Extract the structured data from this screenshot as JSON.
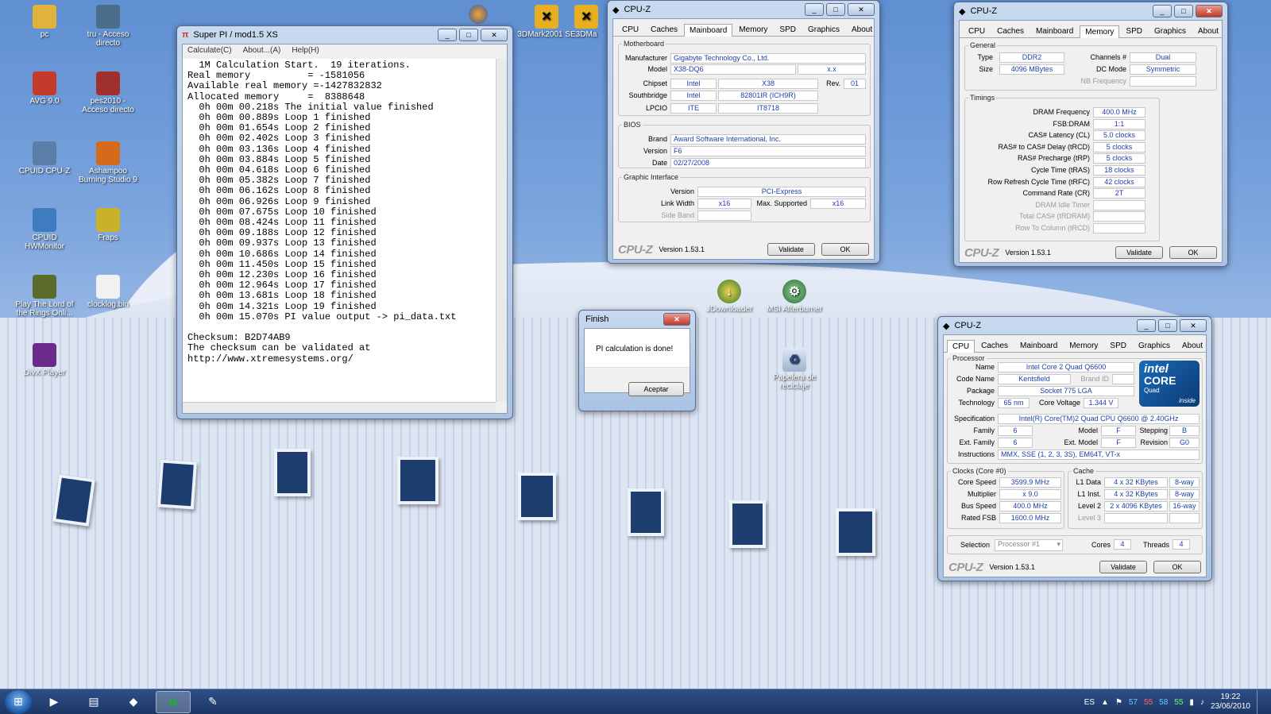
{
  "desktop_icons": [
    {
      "label": "pc",
      "icon": "folder-icon",
      "color": "#e0b43c"
    },
    {
      "label": "tru - Acceso directo",
      "icon": "shortcut-icon",
      "color": "#4a6d8a"
    },
    {
      "label": "AVG 9.0",
      "icon": "avg-icon",
      "color": "#c43b2b"
    },
    {
      "label": "pes2010 - Acceso directo",
      "icon": "shortcut-icon",
      "color": "#a03030"
    },
    {
      "label": "CPUID CPU-Z",
      "icon": "cpuz-icon",
      "color": "#5a7ea8"
    },
    {
      "label": "Ashampoo Burning Studio 9",
      "icon": "burn-icon",
      "color": "#d46a1a"
    },
    {
      "label": "CPUID HWMonitor",
      "icon": "hwmonitor-icon",
      "color": "#3e7bbf"
    },
    {
      "label": "Fraps",
      "icon": "fraps-icon",
      "color": "#c9b12a"
    },
    {
      "label": "Play The Lord of the Rings Onli...",
      "icon": "game-icon",
      "color": "#5a6b2a"
    },
    {
      "label": "clocklog.bin",
      "icon": "file-icon",
      "color": "#f1f1f1"
    },
    {
      "label": "DivX Player",
      "icon": "divx-icon",
      "color": "#6a2b8a"
    }
  ],
  "top_icons": [
    {
      "label": "3DMark2001 SE"
    },
    {
      "label": "3DMa"
    }
  ],
  "mid_icons": [
    {
      "label": "JDownloader"
    },
    {
      "label": "MSI Afterburner"
    },
    {
      "label": "Papelera de reciclaje"
    }
  ],
  "superpi": {
    "title": "Super PI / mod1.5 XS",
    "menu": [
      "Calculate(C)",
      "About...(A)",
      "Help(H)"
    ],
    "lines": [
      "  1M Calculation Start.  19 iterations.",
      "Real memory          = -1581056",
      "Available real memory =-1427832832",
      "Allocated memory     =  8388648",
      "  0h 00m 00.218s The initial value finished",
      "  0h 00m 00.889s Loop 1 finished",
      "  0h 00m 01.654s Loop 2 finished",
      "  0h 00m 02.402s Loop 3 finished",
      "  0h 00m 03.136s Loop 4 finished",
      "  0h 00m 03.884s Loop 5 finished",
      "  0h 00m 04.618s Loop 6 finished",
      "  0h 00m 05.382s Loop 7 finished",
      "  0h 00m 06.162s Loop 8 finished",
      "  0h 00m 06.926s Loop 9 finished",
      "  0h 00m 07.675s Loop 10 finished",
      "  0h 00m 08.424s Loop 11 finished",
      "  0h 00m 09.188s Loop 12 finished",
      "  0h 00m 09.937s Loop 13 finished",
      "  0h 00m 10.686s Loop 14 finished",
      "  0h 00m 11.450s Loop 15 finished",
      "  0h 00m 12.230s Loop 16 finished",
      "  0h 00m 12.964s Loop 17 finished",
      "  0h 00m 13.681s Loop 18 finished",
      "  0h 00m 14.321s Loop 19 finished",
      "  0h 00m 15.070s PI value output -> pi_data.txt",
      "",
      "Checksum: B2D74AB9",
      "The checksum can be validated at",
      "http://www.xtremesystems.org/"
    ]
  },
  "finish_dialog": {
    "title": "Finish",
    "message": "PI calculation is done!",
    "button": "Aceptar"
  },
  "cpuz_tabs": [
    "CPU",
    "Caches",
    "Mainboard",
    "Memory",
    "SPD",
    "Graphics",
    "About"
  ],
  "cpuz_common": {
    "title": "CPU-Z",
    "logo": "CPU-Z",
    "version": "Version 1.53.1",
    "validate": "Validate",
    "ok": "OK"
  },
  "mainboard": {
    "legend_mb": "Motherboard",
    "legend_bios": "BIOS",
    "legend_gi": "Graphic Interface",
    "manufacturer_lbl": "Manufacturer",
    "manufacturer": "Gigabyte Technology Co., Ltd.",
    "model_lbl": "Model",
    "model": "X38-DQ6",
    "model_rev": "x.x",
    "chipset_lbl": "Chipset",
    "chipset_v": "Intel",
    "chipset_m": "X38",
    "rev_lbl": "Rev.",
    "rev": "01",
    "south_lbl": "Southbridge",
    "south_v": "Intel",
    "south_m": "82801IR (ICH9R)",
    "lpcio_lbl": "LPCIO",
    "lpcio_v": "ITE",
    "lpcio_m": "IT8718",
    "brand_lbl": "Brand",
    "brand": "Award Software International, Inc.",
    "version_lbl": "Version",
    "version": "F6",
    "date_lbl": "Date",
    "date": "02/27/2008",
    "gi_version_lbl": "Version",
    "gi_version": "PCI-Express",
    "link_lbl": "Link Width",
    "link": "x16",
    "max_lbl": "Max. Supported",
    "max": "x16",
    "side_lbl": "Side Band"
  },
  "memory": {
    "legend_gen": "General",
    "legend_tim": "Timings",
    "type_lbl": "Type",
    "type": "DDR2",
    "channels_lbl": "Channels #",
    "channels": "Dual",
    "size_lbl": "Size",
    "size": "4096 MBytes",
    "dc_lbl": "DC Mode",
    "dc": "Symmetric",
    "nb_lbl": "NB Frequency",
    "timings": [
      {
        "label": "DRAM Frequency",
        "value": "400.0 MHz",
        "dim": false
      },
      {
        "label": "FSB:DRAM",
        "value": "1:1",
        "dim": false
      },
      {
        "label": "CAS# Latency (CL)",
        "value": "5.0 clocks",
        "dim": false
      },
      {
        "label": "RAS# to CAS# Delay (tRCD)",
        "value": "5 clocks",
        "dim": false
      },
      {
        "label": "RAS# Precharge (tRP)",
        "value": "5 clocks",
        "dim": false
      },
      {
        "label": "Cycle Time (tRAS)",
        "value": "18 clocks",
        "dim": false
      },
      {
        "label": "Row Refresh Cycle Time (tRFC)",
        "value": "42 clocks",
        "dim": false
      },
      {
        "label": "Command Rate (CR)",
        "value": "2T",
        "dim": false
      },
      {
        "label": "DRAM Idle Timer",
        "value": "",
        "dim": true
      },
      {
        "label": "Total CAS# (tRDRAM)",
        "value": "",
        "dim": true
      },
      {
        "label": "Row To Column (tRCD)",
        "value": "",
        "dim": true
      }
    ]
  },
  "cpu": {
    "legend_proc": "Processor",
    "legend_clocks": "Clocks (Core #0)",
    "legend_cache": "Cache",
    "name_lbl": "Name",
    "name": "Intel Core 2 Quad Q6600",
    "code_lbl": "Code Name",
    "code": "Kentsfield",
    "brand_lbl": "Brand ID",
    "package_lbl": "Package",
    "package": "Socket 775 LGA",
    "tech_lbl": "Technology",
    "tech": "65 nm",
    "volt_lbl": "Core Voltage",
    "volt": "1.344 V",
    "spec_lbl": "Specification",
    "spec": "Intel(R) Core(TM)2 Quad CPU   Q6600  @ 2.40GHz",
    "family_lbl": "Family",
    "family": "6",
    "model_lbl": "Model",
    "model": "F",
    "stepping_lbl": "Stepping",
    "stepping": "B",
    "extfam_lbl": "Ext. Family",
    "extfam": "6",
    "extmod_lbl": "Ext. Model",
    "extmod": "F",
    "revision_lbl": "Revision",
    "revision": "G0",
    "instr_lbl": "Instructions",
    "instr": "MMX, SSE (1, 2, 3, 3S), EM64T, VT-x",
    "core_speed_lbl": "Core Speed",
    "core_speed": "3599.9 MHz",
    "mult_lbl": "Multiplier",
    "mult": "x 9.0",
    "bus_lbl": "Bus Speed",
    "bus": "400.0 MHz",
    "fsb_lbl": "Rated FSB",
    "fsb": "1600.0 MHz",
    "l1d_lbl": "L1 Data",
    "l1d": "4 x 32 KBytes",
    "l1d_way": "8-way",
    "l1i_lbl": "L1 Inst.",
    "l1i": "4 x 32 KBytes",
    "l1i_way": "8-way",
    "l2_lbl": "Level 2",
    "l2": "2 x 4096 KBytes",
    "l2_way": "16-way",
    "l3_lbl": "Level 3",
    "sel_lbl": "Selection",
    "sel": "Processor #1",
    "cores_lbl": "Cores",
    "cores": "4",
    "threads_lbl": "Threads",
    "threads": "4",
    "intel_top": "intel",
    "intel_core": "CORE",
    "intel_quad": "Quad",
    "intel_inside": "inside"
  },
  "tray": {
    "lang": "ES",
    "time": "19:22",
    "date": "23/06/2010",
    "temps": [
      "57",
      "55",
      "58",
      "55"
    ]
  }
}
